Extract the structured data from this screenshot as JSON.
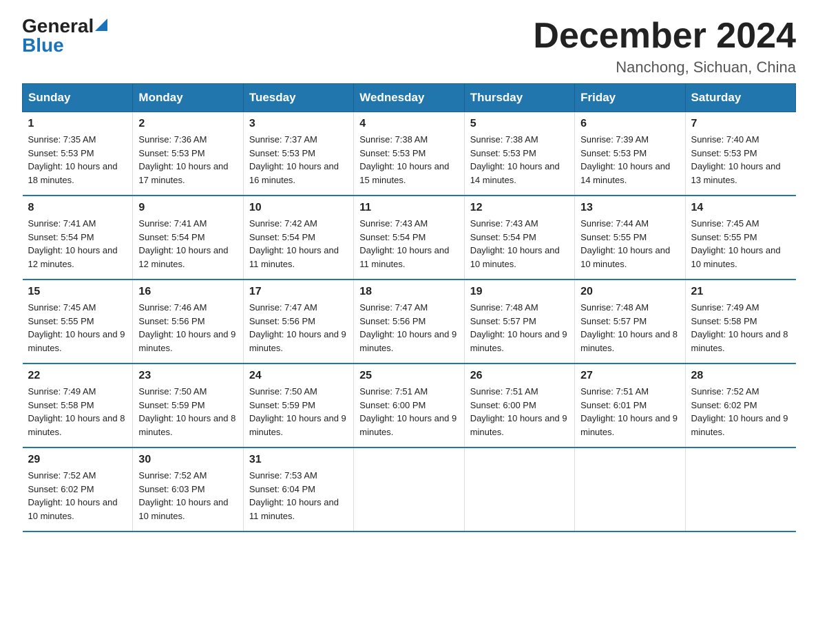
{
  "header": {
    "logo_general": "General",
    "logo_blue": "Blue",
    "title": "December 2024",
    "location": "Nanchong, Sichuan, China"
  },
  "days_of_week": [
    "Sunday",
    "Monday",
    "Tuesday",
    "Wednesday",
    "Thursday",
    "Friday",
    "Saturday"
  ],
  "weeks": [
    [
      {
        "day": "1",
        "sunrise": "7:35 AM",
        "sunset": "5:53 PM",
        "daylight": "10 hours and 18 minutes."
      },
      {
        "day": "2",
        "sunrise": "7:36 AM",
        "sunset": "5:53 PM",
        "daylight": "10 hours and 17 minutes."
      },
      {
        "day": "3",
        "sunrise": "7:37 AM",
        "sunset": "5:53 PM",
        "daylight": "10 hours and 16 minutes."
      },
      {
        "day": "4",
        "sunrise": "7:38 AM",
        "sunset": "5:53 PM",
        "daylight": "10 hours and 15 minutes."
      },
      {
        "day": "5",
        "sunrise": "7:38 AM",
        "sunset": "5:53 PM",
        "daylight": "10 hours and 14 minutes."
      },
      {
        "day": "6",
        "sunrise": "7:39 AM",
        "sunset": "5:53 PM",
        "daylight": "10 hours and 14 minutes."
      },
      {
        "day": "7",
        "sunrise": "7:40 AM",
        "sunset": "5:53 PM",
        "daylight": "10 hours and 13 minutes."
      }
    ],
    [
      {
        "day": "8",
        "sunrise": "7:41 AM",
        "sunset": "5:54 PM",
        "daylight": "10 hours and 12 minutes."
      },
      {
        "day": "9",
        "sunrise": "7:41 AM",
        "sunset": "5:54 PM",
        "daylight": "10 hours and 12 minutes."
      },
      {
        "day": "10",
        "sunrise": "7:42 AM",
        "sunset": "5:54 PM",
        "daylight": "10 hours and 11 minutes."
      },
      {
        "day": "11",
        "sunrise": "7:43 AM",
        "sunset": "5:54 PM",
        "daylight": "10 hours and 11 minutes."
      },
      {
        "day": "12",
        "sunrise": "7:43 AM",
        "sunset": "5:54 PM",
        "daylight": "10 hours and 10 minutes."
      },
      {
        "day": "13",
        "sunrise": "7:44 AM",
        "sunset": "5:55 PM",
        "daylight": "10 hours and 10 minutes."
      },
      {
        "day": "14",
        "sunrise": "7:45 AM",
        "sunset": "5:55 PM",
        "daylight": "10 hours and 10 minutes."
      }
    ],
    [
      {
        "day": "15",
        "sunrise": "7:45 AM",
        "sunset": "5:55 PM",
        "daylight": "10 hours and 9 minutes."
      },
      {
        "day": "16",
        "sunrise": "7:46 AM",
        "sunset": "5:56 PM",
        "daylight": "10 hours and 9 minutes."
      },
      {
        "day": "17",
        "sunrise": "7:47 AM",
        "sunset": "5:56 PM",
        "daylight": "10 hours and 9 minutes."
      },
      {
        "day": "18",
        "sunrise": "7:47 AM",
        "sunset": "5:56 PM",
        "daylight": "10 hours and 9 minutes."
      },
      {
        "day": "19",
        "sunrise": "7:48 AM",
        "sunset": "5:57 PM",
        "daylight": "10 hours and 9 minutes."
      },
      {
        "day": "20",
        "sunrise": "7:48 AM",
        "sunset": "5:57 PM",
        "daylight": "10 hours and 8 minutes."
      },
      {
        "day": "21",
        "sunrise": "7:49 AM",
        "sunset": "5:58 PM",
        "daylight": "10 hours and 8 minutes."
      }
    ],
    [
      {
        "day": "22",
        "sunrise": "7:49 AM",
        "sunset": "5:58 PM",
        "daylight": "10 hours and 8 minutes."
      },
      {
        "day": "23",
        "sunrise": "7:50 AM",
        "sunset": "5:59 PM",
        "daylight": "10 hours and 8 minutes."
      },
      {
        "day": "24",
        "sunrise": "7:50 AM",
        "sunset": "5:59 PM",
        "daylight": "10 hours and 9 minutes."
      },
      {
        "day": "25",
        "sunrise": "7:51 AM",
        "sunset": "6:00 PM",
        "daylight": "10 hours and 9 minutes."
      },
      {
        "day": "26",
        "sunrise": "7:51 AM",
        "sunset": "6:00 PM",
        "daylight": "10 hours and 9 minutes."
      },
      {
        "day": "27",
        "sunrise": "7:51 AM",
        "sunset": "6:01 PM",
        "daylight": "10 hours and 9 minutes."
      },
      {
        "day": "28",
        "sunrise": "7:52 AM",
        "sunset": "6:02 PM",
        "daylight": "10 hours and 9 minutes."
      }
    ],
    [
      {
        "day": "29",
        "sunrise": "7:52 AM",
        "sunset": "6:02 PM",
        "daylight": "10 hours and 10 minutes."
      },
      {
        "day": "30",
        "sunrise": "7:52 AM",
        "sunset": "6:03 PM",
        "daylight": "10 hours and 10 minutes."
      },
      {
        "day": "31",
        "sunrise": "7:53 AM",
        "sunset": "6:04 PM",
        "daylight": "10 hours and 11 minutes."
      },
      null,
      null,
      null,
      null
    ]
  ]
}
